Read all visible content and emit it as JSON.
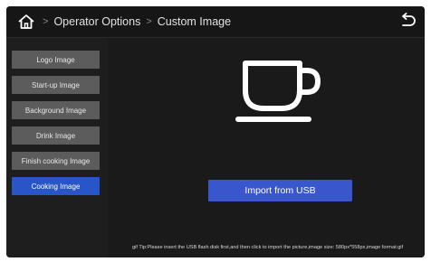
{
  "header": {
    "home_icon": "home-icon",
    "crumbs": [
      "Operator Options",
      "Custom Image"
    ],
    "separator": ">",
    "back_icon": "undo-arrow-icon"
  },
  "sidebar": {
    "items": [
      {
        "label": "Logo Image",
        "active": false
      },
      {
        "label": "Start-up Image",
        "active": false
      },
      {
        "label": "Background Image",
        "active": false
      },
      {
        "label": "Drink Image",
        "active": false
      },
      {
        "label": "Finish cooking Image",
        "active": false
      },
      {
        "label": "Cooking Image",
        "active": true
      }
    ],
    "active_color": "#2855c8",
    "inactive_color": "#5c5c5c"
  },
  "main": {
    "preview_icon": "coffee-cup-icon",
    "import_button": "Import from USB",
    "tip": "gif Tip:Please insert the USB flash disk first,and then click to import the picture,image size: 580px*558px,image format:gif"
  },
  "colors": {
    "background": "#1a1a1a",
    "button_blue": "#3a56cc"
  }
}
